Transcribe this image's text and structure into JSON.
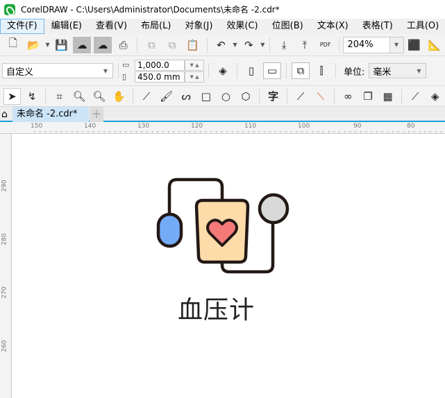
{
  "window": {
    "title": "CorelDRAW - C:\\Users\\Administrator\\Documents\\未命名 -2.cdr*"
  },
  "menu": [
    "文件(F)",
    "编辑(E)",
    "查看(V)",
    "布局(L)",
    "对象(J)",
    "效果(C)",
    "位图(B)",
    "文本(X)",
    "表格(T)",
    "工具(O)"
  ],
  "standard_toolbar": {
    "zoom": "204%",
    "pdf_label": "PDF"
  },
  "property_bar": {
    "page_size": "自定义",
    "width": "1,000.0 mm",
    "height": "450.0 mm",
    "units_label": "单位:",
    "units": "毫米"
  },
  "document_tab": {
    "name": "未命名 -2.cdr*",
    "add": "+"
  },
  "rulers": {
    "horizontal": [
      "150",
      "140",
      "130",
      "120",
      "110",
      "100",
      "90",
      "80"
    ],
    "vertical": [
      "290",
      "280",
      "270",
      "260"
    ]
  },
  "artwork": {
    "text": "血压计",
    "colors": {
      "outline": "#231815",
      "body": "#fedcaa",
      "heart": "#f47a7a",
      "bulb": "#74abf7",
      "gauge": "#d9d9d9"
    }
  }
}
